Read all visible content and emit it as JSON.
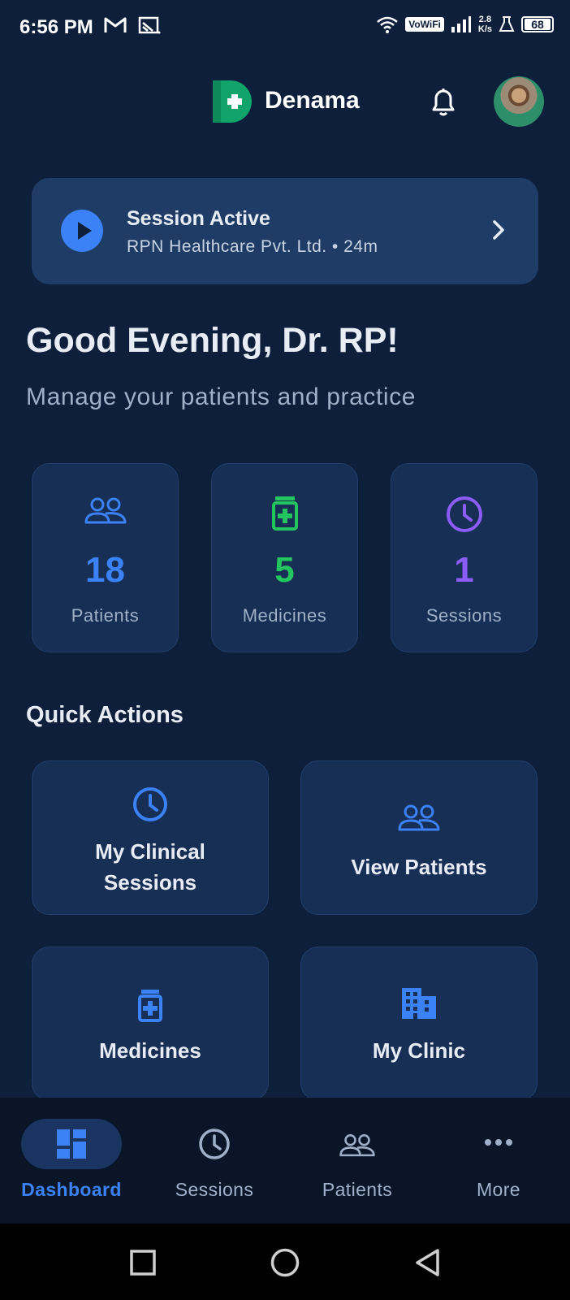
{
  "status_bar": {
    "time": "6:56 PM",
    "icons_left": [
      "gmail-icon",
      "cast-icon"
    ],
    "vowifi": "VoWiFi",
    "speed_value": "2.8",
    "speed_unit": "K/s",
    "battery": "68"
  },
  "header": {
    "brand": "Denama",
    "logo_letter": "D",
    "colors": {
      "logo": "#10a36a",
      "accent": "#3b82f6"
    }
  },
  "session_banner": {
    "title": "Session Active",
    "subtitle": "RPN Healthcare Pvt. Ltd. • 24m"
  },
  "greeting": {
    "title": "Good Evening, Dr. RP!",
    "subtitle": "Manage your patients and practice"
  },
  "stats": [
    {
      "icon": "users-icon",
      "value": "18",
      "label": "Patients",
      "color": "#3b82f6"
    },
    {
      "icon": "medicine-bottle-icon",
      "value": "5",
      "label": "Medicines",
      "color": "#22c55e"
    },
    {
      "icon": "clock-icon",
      "value": "1",
      "label": "Sessions",
      "color": "#8b5cf6"
    }
  ],
  "quick_actions": {
    "title": "Quick Actions",
    "items": [
      {
        "icon": "clock-icon",
        "label_line1": "My Clinical",
        "label_line2": "Sessions"
      },
      {
        "icon": "users-icon",
        "label_line1": "View Patients"
      },
      {
        "icon": "medicine-bottle-icon",
        "label_line1": "Medicines"
      },
      {
        "icon": "building-icon",
        "label_line1": "My Clinic"
      }
    ]
  },
  "bottom_nav": {
    "items": [
      {
        "icon": "dashboard-icon",
        "label": "Dashboard",
        "active": true
      },
      {
        "icon": "clock-icon",
        "label": "Sessions",
        "active": false
      },
      {
        "icon": "users-icon",
        "label": "Patients",
        "active": false
      },
      {
        "icon": "more-dots-icon",
        "label": "More",
        "active": false
      }
    ]
  }
}
